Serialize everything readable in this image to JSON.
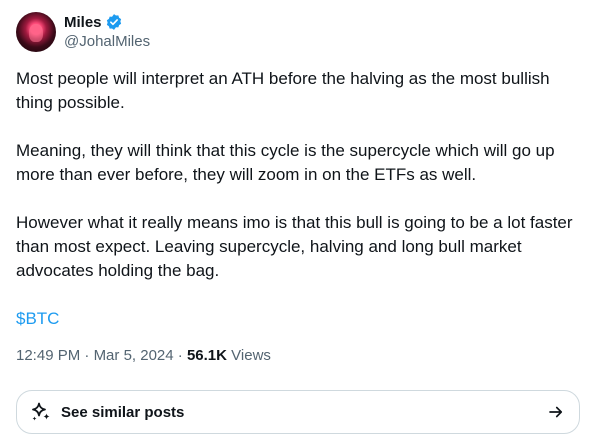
{
  "author": {
    "display_name": "Miles",
    "handle": "@JohalMiles",
    "verified_icon": "verified-badge-icon",
    "verified_color": "#1d9bf0"
  },
  "post": {
    "paragraphs": [
      "Most people will interpret an ATH before the halving as the most bullish thing possible.",
      "Meaning, they will think that this cycle is the supercycle which will go up more than ever before, they will zoom in on the ETFs as well.",
      "However what it really means imo is that this bull is going to be a lot faster than most expect. Leaving supercycle, halving and long bull market advocates holding the bag."
    ],
    "cashtag": "$BTC"
  },
  "meta": {
    "time": "12:49 PM",
    "separator": "·",
    "date": "Mar 5, 2024",
    "views_count": "56.1K",
    "views_label": "Views"
  },
  "similar_posts": {
    "label": "See similar posts",
    "icon": "sparkle-icon",
    "arrow_icon": "arrow-right-icon"
  },
  "colors": {
    "link": "#1d9bf0",
    "text": "#0f1419",
    "secondary": "#536471",
    "border": "#cfd9de"
  }
}
